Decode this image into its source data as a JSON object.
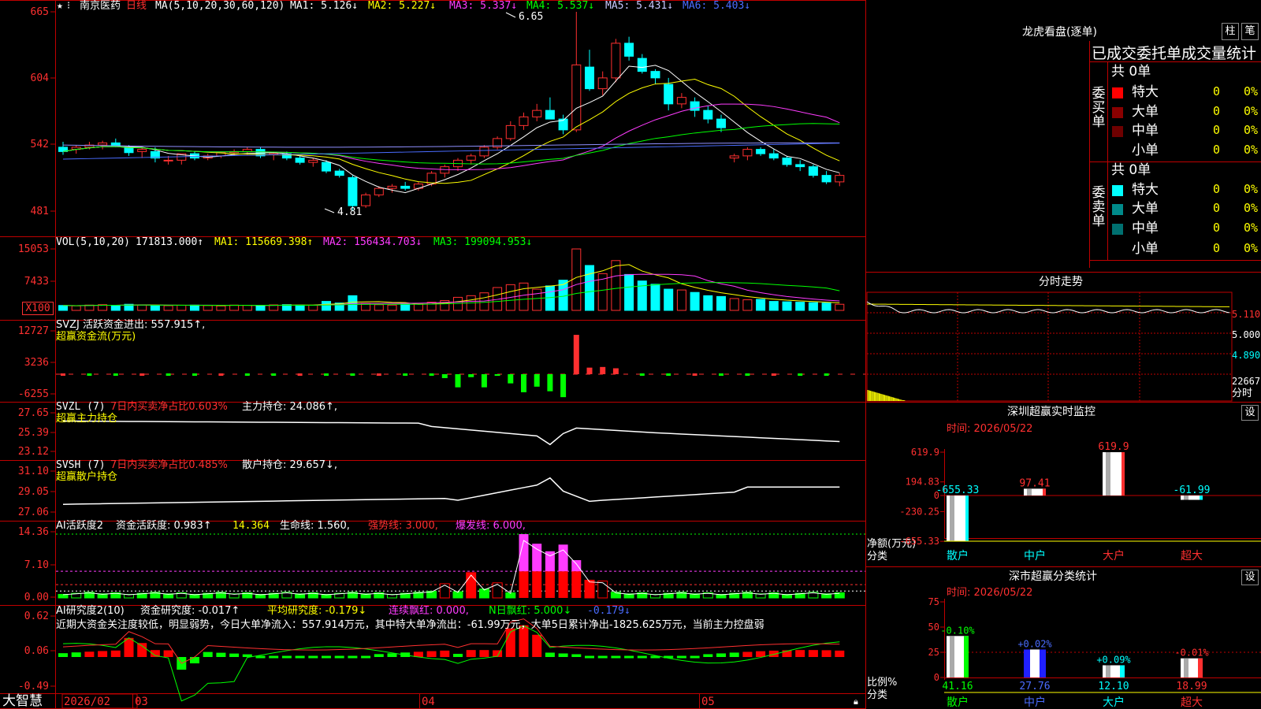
{
  "header": {
    "stock_name": "南京医药",
    "period": "日线",
    "ma_label": "MA(5,10,20,30,60,120)",
    "ma1": "MA1: 5.126↓",
    "ma2": "MA2: 5.227↓",
    "ma3": "MA3: 5.337↓",
    "ma4": "MA4: 5.537↓",
    "ma5": "MA5: 5.431↓",
    "ma6": "MA6: 5.403↓",
    "high_mark": "6.65",
    "low_mark": "4.81"
  },
  "main_axis": [
    "665",
    "604",
    "542",
    "481"
  ],
  "vol": {
    "label": "VOL(5,10,20)",
    "value": "171813.000↑",
    "ma1": "MA1: 115669.398↑",
    "ma2": "MA2: 156434.703↓",
    "ma3": "MA3: 199094.953↓",
    "axis": [
      "15053",
      "7433",
      "X100"
    ]
  },
  "svzj": {
    "line1": "SVZJ  活跃资金进出: 557.915↑,",
    "line2": "超赢资金流(万元)",
    "axis": [
      "12727",
      "3236",
      "-6255"
    ]
  },
  "svzl": {
    "name": "SVZL (7)",
    "ratio": "7日内买卖净占比0.603%",
    "hold": "主力持仓: 24.086↑,",
    "sub": "超赢主力持仓",
    "axis": [
      "27.65",
      "25.39",
      "23.12"
    ]
  },
  "svsh": {
    "name": "SVSH (7)",
    "ratio": "7日内买卖净占比0.485%",
    "hold": "散户持仓: 29.657↓,",
    "sub": "超赢散户持仓",
    "axis": [
      "31.10",
      "29.05",
      "27.06"
    ]
  },
  "ai_active": {
    "name": "AI活跃度2",
    "a": "资金活跃度: 0.983↑",
    "b": "14.364",
    "c": "生命线: 1.560,",
    "d": "强势线: 3.000,",
    "e": "爆发线: 6.000,",
    "axis": [
      "14.36",
      "7.10",
      "0.00"
    ]
  },
  "ai_research": {
    "name": "AI研究度2(10)",
    "a": "资金研究度: -0.017↑",
    "b": "平均研究度: -0.179↓",
    "c": "连续飘红: 0.000,",
    "d": "N日飘红: 5.000↓",
    "e": "-0.179↓",
    "comment": "近期大资金关注度较低，明显弱势，今日大单净流入：557.914万元，其中特大单净流出：-61.99万元，大单5日累计净出-1825.625万元，当前主力控盘弱",
    "axis": [
      "0.62",
      "0.06",
      "-0.49"
    ]
  },
  "bottom_bar": {
    "brand": "大智慧",
    "date_label": "2026/02",
    "months": [
      "03",
      "04",
      "05"
    ]
  },
  "right": {
    "lhb_title": "龙虎看盘(逐单)",
    "btn_zhu": "柱",
    "btn_bi": "笔",
    "table_title": "已成交委托单成交量统计",
    "buy_label": "委买单",
    "sell_label": "委卖单",
    "buy_total": "共 0单",
    "sell_total": "共 0单",
    "rows": [
      {
        "name": "特大",
        "val": "0",
        "pct": "0%"
      },
      {
        "name": "大单",
        "val": "0",
        "pct": "0%"
      },
      {
        "name": "中单",
        "val": "0",
        "pct": "0%"
      },
      {
        "name": "小单",
        "val": "0",
        "pct": "0%"
      }
    ],
    "sell_rows": [
      {
        "name": "特大",
        "val": "0",
        "pct": "0%"
      },
      {
        "name": "大单",
        "val": "0",
        "pct": "0%"
      },
      {
        "name": "中单",
        "val": "0",
        "pct": "0%"
      },
      {
        "name": "小单",
        "val": "0",
        "pct": "0%"
      }
    ],
    "fs_title": "分时走势",
    "fs_axis": [
      "5.110",
      "5.000",
      "4.890",
      "22667",
      "分时"
    ],
    "monitor_title": "深圳超赢实时监控",
    "monitor_time": "时间: 2026/05/22",
    "set_btn": "设",
    "monitor_axis": [
      "619.9",
      "194.83",
      "0",
      "-230.25",
      "-655.33"
    ],
    "monitor_ylabel": "净额(万元)",
    "monitor_xlabel": "分类",
    "class_title": "深市超赢分类统计",
    "class_time": "时间: 2026/05/22",
    "class_axis": [
      "75",
      "50",
      "25",
      "0"
    ],
    "class_ylabel": "比例%",
    "class_xlabel": "分类"
  },
  "chart_data": [
    {
      "type": "bar",
      "title": "深圳超赢实时监控",
      "categories": [
        "散户",
        "中户",
        "大户",
        "超大"
      ],
      "values": [
        -655.33,
        97.41,
        619.9,
        -61.99
      ],
      "ylabel": "净额(万元)",
      "xlabel": "分类",
      "ylim": [
        -655.33,
        619.9
      ]
    },
    {
      "type": "bar",
      "title": "深市超赢分类统计",
      "categories": [
        "散户",
        "中户",
        "大户",
        "超大"
      ],
      "values": [
        41.16,
        27.76,
        12.1,
        18.99
      ],
      "changes": [
        "-0.10%",
        "+0.02%",
        "+0.09%",
        "-0.01%"
      ],
      "ylabel": "比例%",
      "xlabel": "分类",
      "ylim": [
        0,
        75
      ]
    }
  ],
  "colors": {
    "up": "#ff3030",
    "down": "#00ffff",
    "grid": "#b00000",
    "ma1": "#ffffff",
    "ma2": "#ffff00",
    "ma3": "#ff3cff",
    "ma4": "#00ff00",
    "ma5": "#9090ff",
    "ma6": "#4a6cff"
  }
}
